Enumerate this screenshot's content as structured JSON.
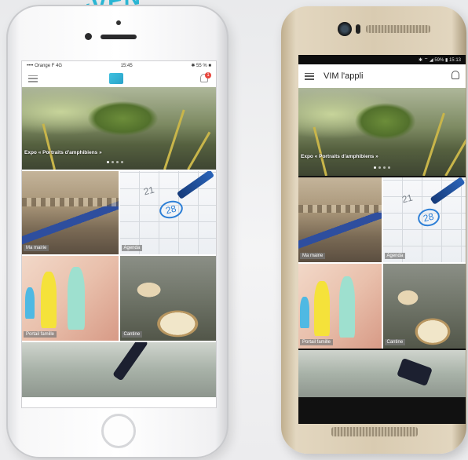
{
  "banner": {
    "text": "«VEN"
  },
  "iphone": {
    "status": {
      "carrier": "•••• Orange F  4G",
      "time": "15:45",
      "battery": "✱ 55 % ■"
    },
    "appbar": {
      "badge_count": "1"
    },
    "hero": {
      "caption": "Expo « Portraits d'amphibiens »"
    },
    "tiles": [
      {
        "label": "Ma mairie"
      },
      {
        "label": "Agenda"
      },
      {
        "label": "Portail famille"
      },
      {
        "label": "Cantine"
      }
    ],
    "agenda": {
      "day1": "21",
      "day2": "28"
    }
  },
  "htc": {
    "status": {
      "right": "✱ ⌔ ◢ 59% ▮ 15:13"
    },
    "appbar": {
      "title": "VIM l'appli"
    },
    "hero": {
      "caption": "Expo « Portraits d'amphibiens »"
    },
    "tiles": [
      {
        "label": "Ma mairie"
      },
      {
        "label": "Agenda"
      },
      {
        "label": "Portail famille"
      },
      {
        "label": "Cantine"
      }
    ],
    "agenda": {
      "day1": "21",
      "day2": "28"
    }
  },
  "colors": {
    "accent": "#2bb8d6",
    "badge": "#e8453c",
    "pen": "#2a63b8"
  }
}
